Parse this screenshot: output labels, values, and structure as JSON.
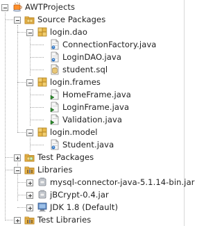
{
  "project": {
    "name": "AWTProjects",
    "icon": "project-coffee-cup-icon"
  },
  "nodes": {
    "source_packages": {
      "label": "Source Packages",
      "icon": "source-folder-icon"
    },
    "login_dao": {
      "label": "login.dao",
      "icon": "package-icon"
    },
    "connection_factory": {
      "label": "ConnectionFactory.java",
      "icon": "java-class-icon"
    },
    "login_dao_java": {
      "label": "LoginDAO.java",
      "icon": "java-class-icon"
    },
    "student_sql": {
      "label": "student.sql",
      "icon": "sql-file-icon"
    },
    "login_frames": {
      "label": "login.frames",
      "icon": "package-icon"
    },
    "home_frame": {
      "label": "HomeFrame.java",
      "icon": "java-runnable-class-icon"
    },
    "login_frame": {
      "label": "LoginFrame.java",
      "icon": "java-runnable-class-icon"
    },
    "validation": {
      "label": "Validation.java",
      "icon": "java-runnable-class-icon"
    },
    "login_model": {
      "label": "login.model",
      "icon": "package-icon"
    },
    "student_java": {
      "label": "Student.java",
      "icon": "java-class-icon"
    },
    "test_packages": {
      "label": "Test Packages",
      "icon": "test-folder-icon"
    },
    "libraries": {
      "label": "Libraries",
      "icon": "libraries-folder-icon"
    },
    "mysql_connector": {
      "label": "mysql-connector-java-5.1.14-bin.jar",
      "icon": "jar-icon"
    },
    "jbcrypt": {
      "label": "jBCrypt-0.4.jar",
      "icon": "jar-icon"
    },
    "jdk": {
      "label": "JDK 1.8 (Default)",
      "icon": "jdk-icon"
    },
    "test_libraries": {
      "label": "Test Libraries",
      "icon": "libraries-folder-icon"
    }
  },
  "colors": {
    "package": "#e1b84f",
    "folder": "#d9a23e",
    "java_file": "#f5f5f5",
    "java_accent": "#2f78c9",
    "runnable_accent": "#2b8a2b",
    "sql_accent": "#c9a14a",
    "jar": "#b8bcc2",
    "jdk": "#3c6ea8"
  }
}
